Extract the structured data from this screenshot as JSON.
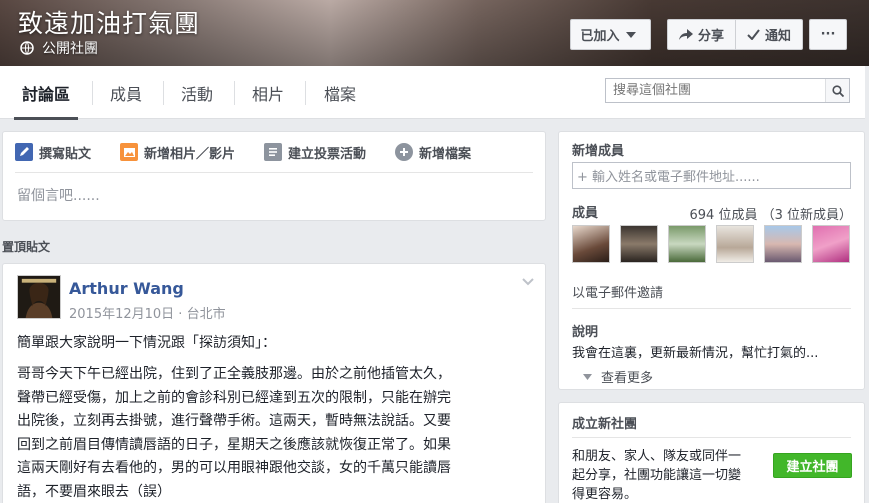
{
  "cover": {
    "title": "致遠加油打氣團",
    "privacy_label": "公開社團",
    "joined_label": "已加入",
    "share_label": "分享",
    "notify_label": "通知",
    "more_label": "···"
  },
  "tabs": [
    {
      "label": "討論區",
      "active": true
    },
    {
      "label": "成員"
    },
    {
      "label": "活動"
    },
    {
      "label": "相片"
    },
    {
      "label": "檔案"
    }
  ],
  "search": {
    "placeholder": "搜尋這個社團"
  },
  "composer": {
    "tabs": [
      {
        "label": "撰寫貼文",
        "icon": "pencil-icon"
      },
      {
        "label": "新增相片／影片",
        "icon": "photo-icon"
      },
      {
        "label": "建立投票活動",
        "icon": "poll-icon"
      },
      {
        "label": "新增檔案",
        "icon": "add-file-icon"
      }
    ],
    "placeholder": "留個言吧......"
  },
  "pinned_label": "置頂貼文",
  "post": {
    "author": "Arthur Wang",
    "meta": "2015年12月10日 · 台北市",
    "intro": "簡單跟大家說明一下情況跟「探訪須知」：",
    "body_lines": [
      "哥哥今天下午已經出院，住到了正全義肢那邊。由於之前他插管太久，",
      "聲帶已經受傷，加上之前的會診科別已經達到五次的限制，只能在辦完",
      "出院後，立刻再去掛號，進行聲帶手術。這兩天，暫時無法說話。又要",
      "回到之前眉目傳情讀唇語的日子，星期天之後應該就恢復正常了。如果",
      "這兩天剛好有去看他的，男的可以用眼神跟他交談，女的千萬只能讀唇",
      "語，不要眉來眼去（誤）"
    ]
  },
  "sidebar": {
    "new_members_heading": "新增成員",
    "add_member_placeholder": "+ 輸入姓名或電子郵件地址......",
    "members_heading": "成員",
    "member_count": "694 位成員 （3 位新成員）",
    "invite_by_email": "以電子郵件邀請",
    "description_heading": "說明",
    "description": "我會在這裏，更新最新情況，幫忙打氣的...",
    "see_more": "查看更多",
    "create_group_heading": "成立新社團",
    "create_group_text": [
      "和朋友、家人、隊友或同伴一",
      "起分享，社團功能讓這一切變",
      "得更容易。"
    ],
    "create_group_button": "建立社團"
  },
  "colors": {
    "link": "#365899",
    "green": "#42b72a",
    "bg": "#e9ebee"
  }
}
